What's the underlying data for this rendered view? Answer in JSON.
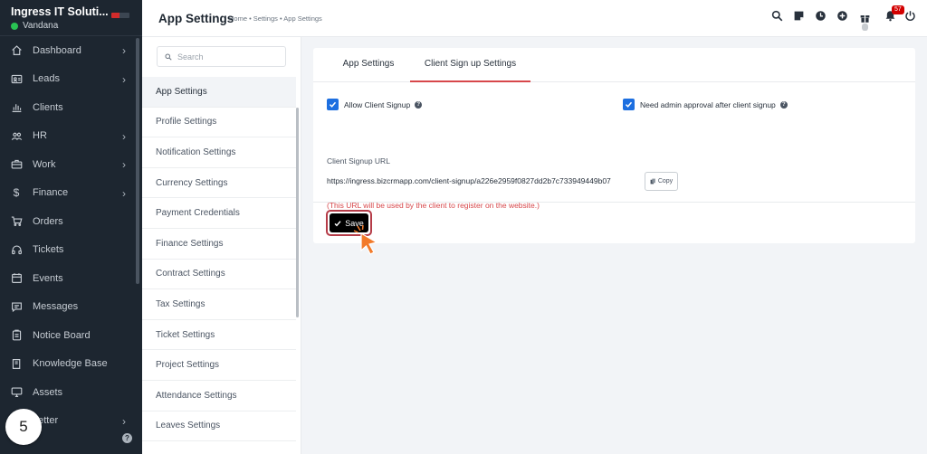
{
  "sidebar": {
    "company": "Ingress IT Soluti...",
    "user": "Vandana",
    "items": [
      {
        "label": "Dashboard",
        "icon": "home-icon",
        "has_children": true
      },
      {
        "label": "Leads",
        "icon": "id-card-icon",
        "has_children": true
      },
      {
        "label": "Clients",
        "icon": "bar-chart-icon",
        "has_children": false
      },
      {
        "label": "HR",
        "icon": "users-icon",
        "has_children": true
      },
      {
        "label": "Work",
        "icon": "briefcase-icon",
        "has_children": true
      },
      {
        "label": "Finance",
        "icon": "dollar-icon",
        "has_children": true
      },
      {
        "label": "Orders",
        "icon": "cart-icon",
        "has_children": false
      },
      {
        "label": "Tickets",
        "icon": "headset-icon",
        "has_children": false
      },
      {
        "label": "Events",
        "icon": "calendar-icon",
        "has_children": false
      },
      {
        "label": "Messages",
        "icon": "chat-icon",
        "has_children": false
      },
      {
        "label": "Notice Board",
        "icon": "clipboard-icon",
        "has_children": false
      },
      {
        "label": "Knowledge Base",
        "icon": "book-icon",
        "has_children": false
      },
      {
        "label": "Assets",
        "icon": "monitor-icon",
        "has_children": false
      },
      {
        "label": "Letter",
        "icon": "letter-icon",
        "has_children": true
      }
    ],
    "step_badge": "5"
  },
  "topbar": {
    "title": "App Settings",
    "breadcrumb": "Home • Settings • App Settings",
    "notification_count": "57"
  },
  "settings_menu": {
    "search_placeholder": "Search",
    "items": [
      {
        "label": "App Settings",
        "active": true
      },
      {
        "label": "Profile Settings",
        "active": false
      },
      {
        "label": "Notification Settings",
        "active": false
      },
      {
        "label": "Currency Settings",
        "active": false
      },
      {
        "label": "Payment Credentials",
        "active": false
      },
      {
        "label": "Finance Settings",
        "active": false
      },
      {
        "label": "Contract Settings",
        "active": false
      },
      {
        "label": "Tax Settings",
        "active": false
      },
      {
        "label": "Ticket Settings",
        "active": false
      },
      {
        "label": "Project Settings",
        "active": false
      },
      {
        "label": "Attendance Settings",
        "active": false
      },
      {
        "label": "Leaves Settings",
        "active": false
      }
    ]
  },
  "main": {
    "tabs": [
      {
        "label": "App Settings",
        "active": false
      },
      {
        "label": "Client Sign up Settings",
        "active": true
      }
    ],
    "allow_signup_label": "Allow Client Signup",
    "allow_signup_checked": true,
    "admin_approval_label": "Need admin approval after client signup",
    "admin_approval_checked": true,
    "url_label": "Client Signup URL",
    "url_value": "https://ingress.bizcrmapp.com/client-signup/a226e2959f0827dd2b7c733949449b07",
    "copy_label": "Copy",
    "url_note": "(This URL will be used by the client to register on the website.)",
    "save_label": "Save"
  },
  "colors": {
    "sidebar_bg": "#1d2630",
    "accent_red": "#d7474a",
    "checkbox_blue": "#1d6fe0",
    "online_green": "#29c253",
    "cursor_orange": "#f27a2a"
  }
}
